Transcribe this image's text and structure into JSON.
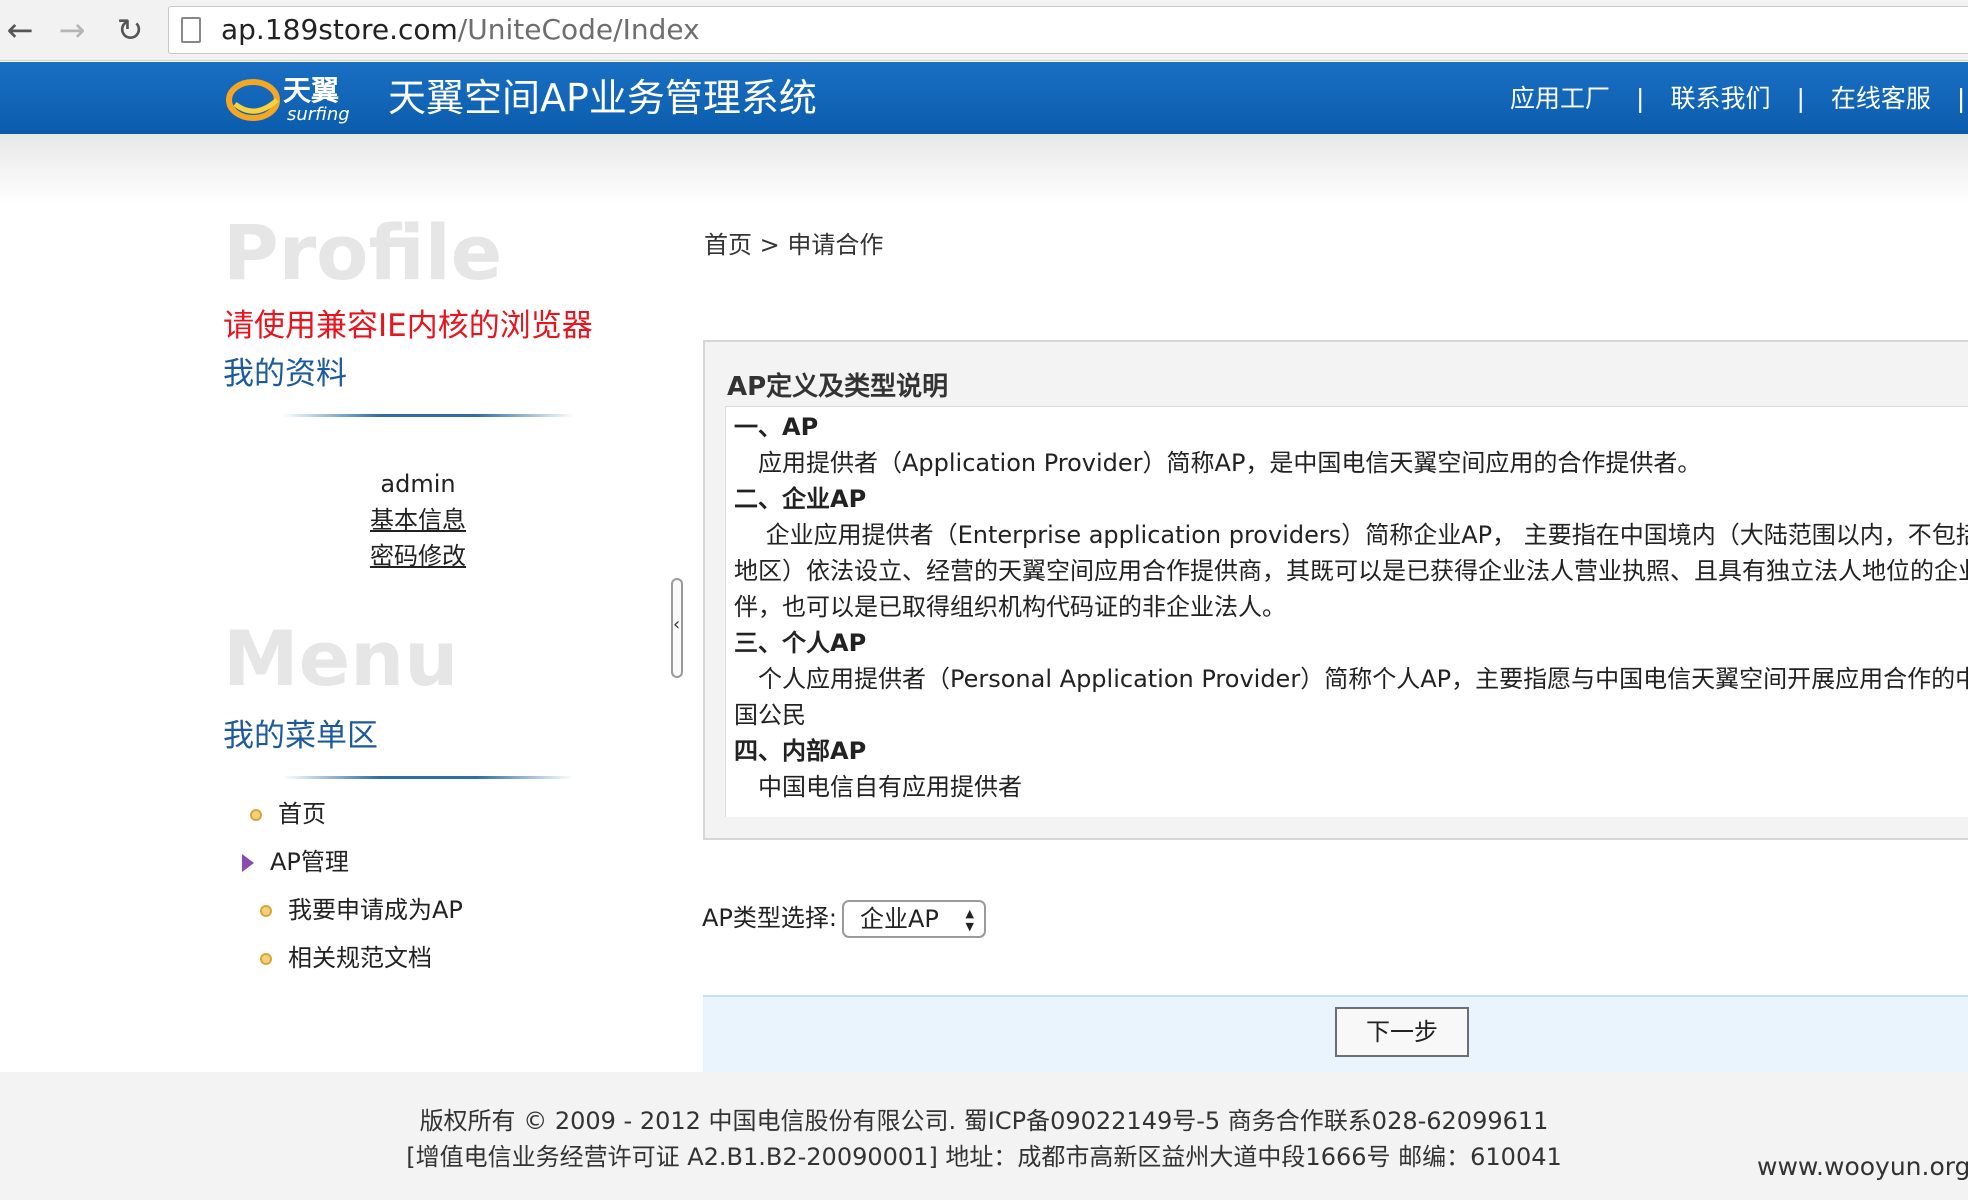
{
  "browser": {
    "url_host": "ap.189store.com",
    "url_path": "/UniteCode/Index"
  },
  "header": {
    "logo_text": "天翼空间AP业务管理系统",
    "logo_brand": "天翼",
    "logo_sub": "surfing",
    "nav": [
      "应用工厂",
      "联系我们",
      "在线客服"
    ],
    "separator": "|"
  },
  "sidebar": {
    "profile_heading": "Profile",
    "warning": "请使用兼容IE内核的浏览器",
    "profile_title": "我的资料",
    "username": "admin",
    "links": [
      "基本信息",
      "密码修改"
    ],
    "menu_heading": "Menu",
    "menu_title": "我的菜单区",
    "menu_items": [
      "首页",
      "AP管理",
      "我要申请成为AP",
      "相关规范文档"
    ]
  },
  "main": {
    "breadcrumb": "首页 > 申请合作",
    "panel_title": "AP定义及类型说明",
    "definitions": [
      "一、AP",
      "　应用提供者（Application Provider）简称AP，是中国电信天翼空间应用的合作提供者。",
      "二、企业AP",
      "　 企业应用提供者（Enterprise application providers）简称企业AP， 主要指在中国境内（大陆范围以内，不包括港、",
      "地区）依法设立、经营的天翼空间应用合作提供商，其既可以是已获得企业法人营业执照、且具有独立法人地位的企业",
      "伴，也可以是已取得组织机构代码证的非企业法人。",
      "三、个人AP",
      "　个人应用提供者（Personal Application Provider）简称个人AP，主要指愿与中国电信天翼空间开展应用合作的中华",
      "国公民",
      "四、内部AP",
      "　中国电信自有应用提供者"
    ],
    "select_label": "AP类型选择:",
    "select_value": "企业AP",
    "next_button": "下一步"
  },
  "footer": {
    "line1": "版权所有 © 2009 - 2012 中国电信股份有限公司. 蜀ICP备09022149号-5 商务合作联系028-62099611",
    "line2": "[增值电信业务经营许可证 A2.B1.B2-20090001] 地址：成都市高新区益州大道中段1666号 邮编：610041"
  },
  "watermark": "www.wooyun.org",
  "colors": {
    "header_blue": "#0b5cad",
    "warning_red": "#e8141e",
    "section_blue": "#1c5a9c",
    "action_bar": "#e9f4fd"
  }
}
